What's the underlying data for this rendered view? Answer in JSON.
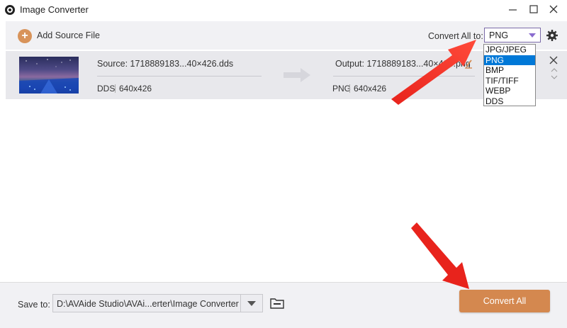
{
  "window": {
    "title": "Image Converter"
  },
  "toolbar": {
    "add_source_label": "Add Source File",
    "convert_all_label": "Convert All to:",
    "format_selected": "PNG"
  },
  "format_dropdown": {
    "options": [
      "JPG/JPEG",
      "PNG",
      "BMP",
      "TIF/TIFF",
      "WEBP",
      "DDS"
    ],
    "selected_index": 1
  },
  "file": {
    "source_name": "Source: 1718889183...40×426.dds",
    "source_format": "DDS",
    "source_size": "640x426",
    "output_name": "Output: 1718889183...40×426.png",
    "output_format": "PNG",
    "output_size": "640x426"
  },
  "footer": {
    "save_to_label": "Save to:",
    "save_path": "D:\\AVAide Studio\\AVAi...erter\\Image Converter",
    "convert_all_button": "Convert All"
  },
  "colors": {
    "accent": "#d4884f",
    "select_border": "#7a6aa8",
    "dropdown_highlight": "#0078d7",
    "annotation_arrow": "#e8231c"
  }
}
